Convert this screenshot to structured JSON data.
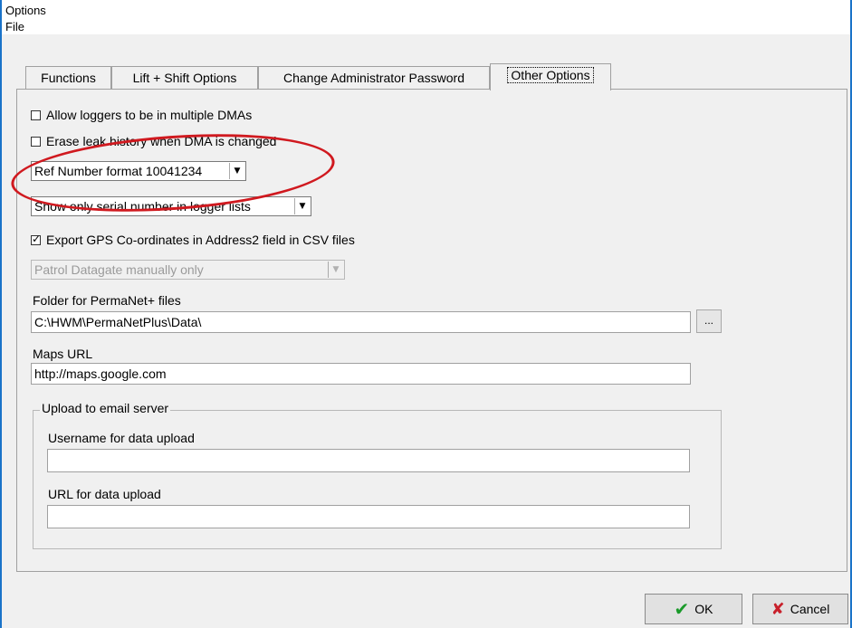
{
  "window": {
    "title": "Options"
  },
  "menu": {
    "file": "File"
  },
  "tabs": [
    {
      "label": "Functions"
    },
    {
      "label": "Lift + Shift Options"
    },
    {
      "label": "Change Administrator Password"
    },
    {
      "label": "Other Options"
    }
  ],
  "options": {
    "multiple_dmas": {
      "label": "Allow loggers to be in multiple DMAs",
      "checked": false
    },
    "erase_leak_history": {
      "label": "Erase leak history when DMA is changed",
      "checked": false
    },
    "ref_number_format": {
      "value": "Ref Number format 10041234"
    },
    "logger_lists": {
      "value": "Show only serial number in logger lists"
    },
    "export_gps": {
      "label": "Export GPS Co-ordinates in Address2 field in CSV files",
      "checked": true
    },
    "patrol_datagate": {
      "value": "Patrol Datagate manually only"
    },
    "folder_label": "Folder for PermaNet+ files",
    "folder_value": "C:\\HWM\\PermaNetPlus\\Data\\",
    "browse_label": "...",
    "maps_label": "Maps URL",
    "maps_value": "http://maps.google.com"
  },
  "upload": {
    "group_label": "Upload to email server",
    "username_label": "Username for data upload",
    "username_value": "",
    "url_label": "URL for data upload",
    "url_value": ""
  },
  "buttons": {
    "ok": "OK",
    "cancel": "Cancel"
  },
  "annotation": {
    "color": "#d0191f"
  }
}
